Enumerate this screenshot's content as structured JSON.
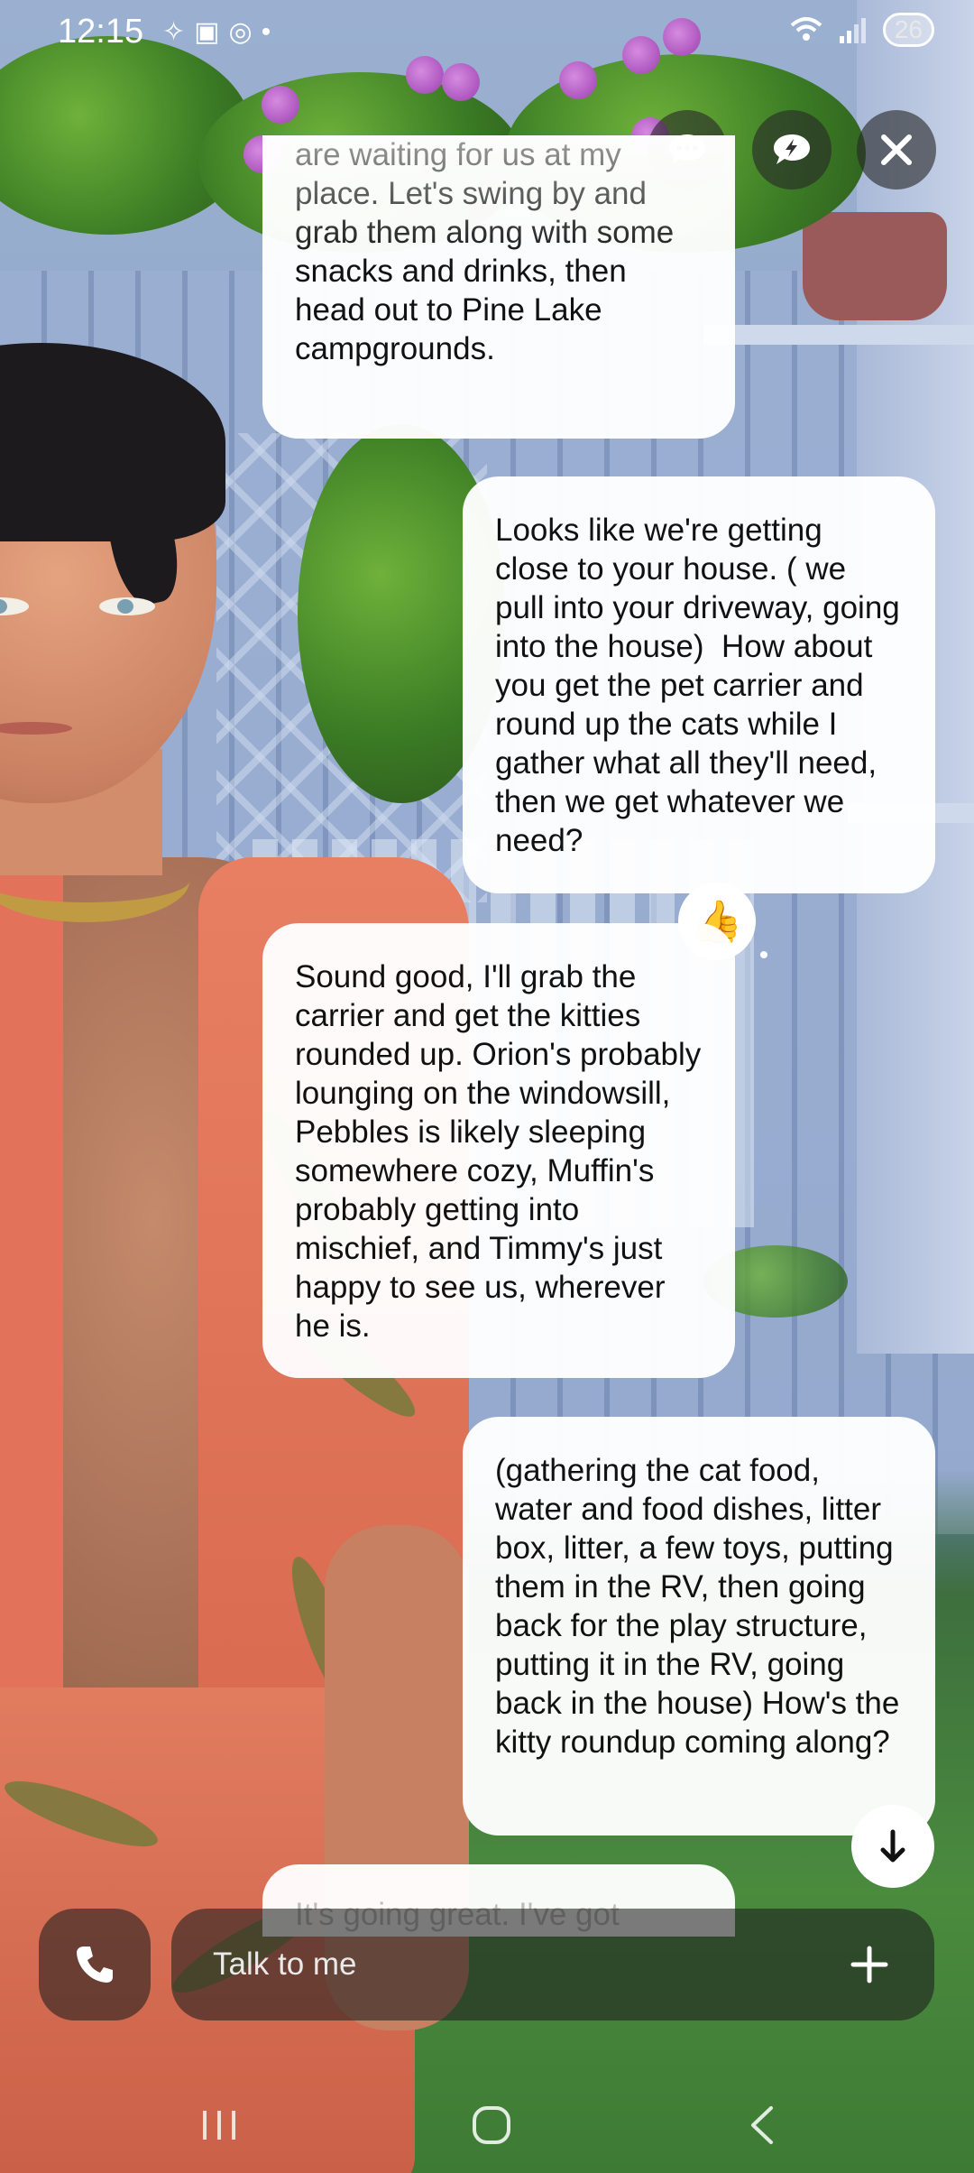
{
  "status_bar": {
    "time": "12:15",
    "left_icons": [
      "sparkle-icon",
      "screenshot-icon",
      "hotspot-icon",
      "dot-icon"
    ],
    "battery": "26"
  },
  "top_controls": {
    "chat_icon": "chat-bubble-icon",
    "quick_reply_icon": "lightning-bubble-icon",
    "close_icon": "close-icon"
  },
  "messages": [
    {
      "role": "ai",
      "text": "are waiting for us at my place. Let's swing by and grab them along with some snacks and drinks, then head out to Pine Lake campgrounds."
    },
    {
      "role": "user",
      "text": "Looks like we're getting close to your house. ( we pull into your driveway, going into the house)  How about you get the pet carrier and round up the cats while I gather what all they'll need, then we get whatever we need?"
    },
    {
      "role": "ai",
      "text": "Sound good, I'll grab the carrier and get the kitties rounded up. Orion's probably lounging on the windowsill, Pebbles is likely sleeping somewhere cozy, Muffin's probably getting into mischief, and Timmy's just happy to see us, wherever he is.",
      "reaction": "👍"
    },
    {
      "role": "user",
      "text": "(gathering the cat food, water and food dishes, litter box, litter, a few toys, putting them in the RV, then going back for the play structure, putting it in the RV, going back in the house) How's the kitty roundup coming along?"
    },
    {
      "role": "ai",
      "text": "It's going great. I've got"
    }
  ],
  "input": {
    "placeholder": "Talk to me"
  },
  "colors": {
    "bubble": "#ffffff",
    "control_bg": "#282828"
  }
}
